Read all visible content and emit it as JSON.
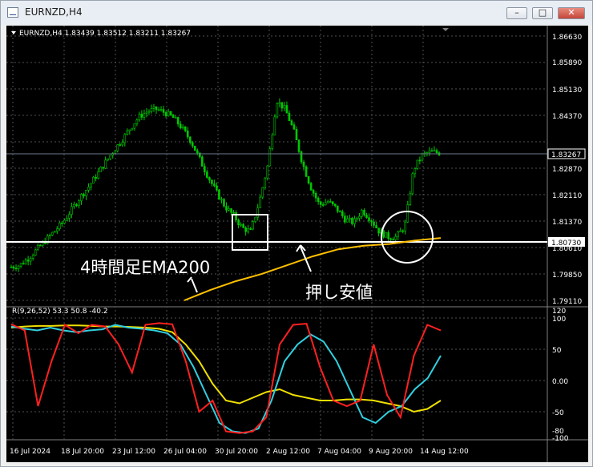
{
  "window": {
    "title": "EURNZD,H4",
    "buttons": [
      "minimize",
      "maximize",
      "close"
    ]
  },
  "header": {
    "info": "EURNZD,H4  1.83439 1.83512 1.83211 1.83267"
  },
  "price_axis": {
    "ticks": [
      "1.86630",
      "1.85890",
      "1.85130",
      "1.84370",
      "1.83267",
      "1.82870",
      "1.82110",
      "1.81370",
      "1.80730",
      "1.80610",
      "1.79850",
      "1.79110"
    ],
    "current": "1.83267",
    "level": "1.80730"
  },
  "indicator": {
    "label": "R(9,26,52) 53.3 50.8 -40.2",
    "ticks": [
      "120",
      "100",
      "50",
      "0.00",
      "-50",
      "-80",
      "-100"
    ]
  },
  "time_axis": {
    "ticks": [
      "16 Jul 2024",
      "18 Jul 20:00",
      "23 Jul 12:00",
      "26 Jul 04:00",
      "30 Jul 20:00",
      "2 Aug 12:00",
      "7 Aug 04:00",
      "9 Aug 20:00",
      "14 Aug 12:00"
    ]
  },
  "annotations": {
    "ema_label": "4時間足EMA200",
    "pullback_label": "押し安値"
  },
  "colors": {
    "candles": "#00c800",
    "ema": "#ffc000",
    "rsi_fast": "#ff2020",
    "rsi_mid": "#30d0e0",
    "rsi_slow": "#f0e000",
    "level": "#ffffff"
  },
  "chart_data": {
    "type": "candlestick",
    "symbol": "EURNZD",
    "timeframe": "H4",
    "price_range": [
      1.7911,
      1.8663
    ],
    "close_path": [
      1.8005,
      1.801,
      1.803,
      1.8055,
      1.808,
      1.8105,
      1.813,
      1.8165,
      1.82,
      1.823,
      1.8265,
      1.83,
      1.8335,
      1.8365,
      1.84,
      1.843,
      1.8445,
      1.845,
      1.844,
      1.8425,
      1.8395,
      1.836,
      1.831,
      1.826,
      1.8215,
      1.8175,
      1.815,
      1.8115,
      1.8105,
      1.819,
      1.8295,
      1.8475,
      1.845,
      1.839,
      1.83,
      1.823,
      1.818,
      1.819,
      1.817,
      1.814,
      1.813,
      1.8165,
      1.814,
      1.8105,
      1.809,
      1.809,
      1.812,
      1.828,
      1.832,
      1.833,
      1.8327
    ],
    "ema200_path": [
      1.7911,
      1.794,
      1.7965,
      1.7985,
      1.801,
      1.8035,
      1.8055,
      1.8065,
      1.807,
      1.808,
      1.8087
    ],
    "level": 1.8073,
    "indicator_range": [
      -110,
      120
    ],
    "rsi_fast": [
      96,
      85,
      -50,
      30,
      95,
      80,
      95,
      92,
      60,
      10,
      95,
      98,
      96,
      30,
      -60,
      -40,
      -95,
      -98,
      -95,
      -70,
      60,
      95,
      97,
      20,
      -40,
      -50,
      -40,
      60,
      -30,
      -70,
      40,
      95,
      85
    ],
    "rsi_mid": [
      92,
      88,
      85,
      90,
      85,
      82,
      85,
      87,
      95,
      90,
      88,
      85,
      80,
      60,
      20,
      -30,
      -80,
      -95,
      -98,
      -90,
      -40,
      30,
      60,
      78,
      65,
      30,
      -20,
      -70,
      -80,
      -60,
      -50,
      -20,
      0,
      40
    ],
    "rsi_slow": [
      90,
      92,
      93,
      93,
      94,
      94,
      93,
      92,
      92,
      91,
      90,
      88,
      82,
      60,
      30,
      -10,
      -40,
      -45,
      -35,
      -25,
      -20,
      -30,
      -35,
      -40,
      -40,
      -38,
      -38,
      -40,
      -45,
      -50,
      -60,
      -55,
      -40
    ]
  }
}
